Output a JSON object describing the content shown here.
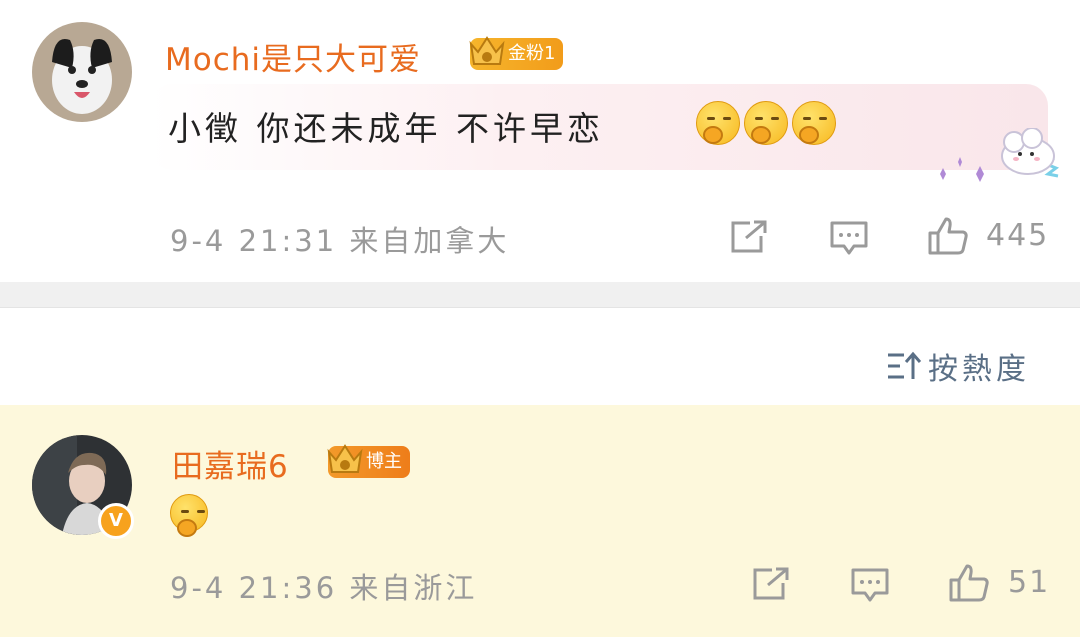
{
  "comments": [
    {
      "username": "Mochi是只大可爱",
      "badge": "金粉1",
      "text": "小徵 你还未成年 不许早恋",
      "time": "9-4 21:31",
      "location": "来自加拿大",
      "likes": "445",
      "emojis": [
        "thinking-face",
        "thinking-face",
        "thinking-face"
      ]
    },
    {
      "username": "田嘉瑞6",
      "badge": "博主",
      "text": "",
      "time": "9-4 21:36",
      "location": "来自浙江",
      "likes": "51",
      "emojis": [
        "sweat-face"
      ]
    }
  ],
  "sort": {
    "label": "按熱度"
  },
  "colors": {
    "username": "#e86b1f",
    "meta": "#9a9a9a",
    "sort": "#5a6f86",
    "highlight_bg": "#fdf8dc"
  }
}
